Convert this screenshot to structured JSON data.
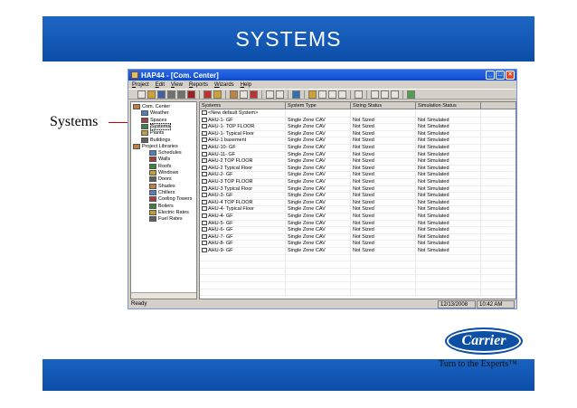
{
  "slide": {
    "title": "SYSTEMS",
    "side_label": "Systems",
    "logo_text": "Carrier",
    "tagline": "Turn to the Experts™",
    "colors": {
      "banner": "#0c4ea8",
      "arrow": "#cc0000"
    }
  },
  "window": {
    "title": "HAP44 - [Com. Center]",
    "controls": [
      "_",
      "□",
      "×"
    ],
    "menu": [
      "Project",
      "Edit",
      "View",
      "Reports",
      "Wizards",
      "Help"
    ]
  },
  "tree": [
    {
      "label": "Com. Center",
      "indent": 0,
      "icon": "folder-icon"
    },
    {
      "label": "Weather",
      "indent": 1,
      "icon": "weather-icon"
    },
    {
      "label": "Spaces",
      "indent": 1,
      "icon": "spaces-icon"
    },
    {
      "label": "Systems",
      "indent": 1,
      "icon": "systems-icon",
      "selected": true
    },
    {
      "label": "Plants",
      "indent": 1,
      "icon": "plants-icon"
    },
    {
      "label": "Buildings",
      "indent": 1,
      "icon": "buildings-icon"
    },
    {
      "label": "Project Libraries",
      "indent": 0,
      "icon": "libraries-icon"
    },
    {
      "label": "Schedules",
      "indent": 2,
      "icon": "schedules-icon"
    },
    {
      "label": "Walls",
      "indent": 2,
      "icon": "walls-icon"
    },
    {
      "label": "Roofs",
      "indent": 2,
      "icon": "roofs-icon"
    },
    {
      "label": "Windows",
      "indent": 2,
      "icon": "windows-icon"
    },
    {
      "label": "Doors",
      "indent": 2,
      "icon": "doors-icon"
    },
    {
      "label": "Shades",
      "indent": 2,
      "icon": "shades-icon"
    },
    {
      "label": "Chillers",
      "indent": 2,
      "icon": "chillers-icon"
    },
    {
      "label": "Cooling Towers",
      "indent": 2,
      "icon": "cooling-towers-icon"
    },
    {
      "label": "Boilers",
      "indent": 2,
      "icon": "boilers-icon"
    },
    {
      "label": "Electric Rates",
      "indent": 2,
      "icon": "electric-rates-icon"
    },
    {
      "label": "Fuel Rates",
      "indent": 2,
      "icon": "fuel-rates-icon"
    }
  ],
  "list": {
    "columns": [
      "Systems",
      "System Type",
      "Sizing Status",
      "Simulation Status"
    ],
    "rows": [
      [
        "<New default System>",
        "",
        "",
        ""
      ],
      [
        "AHU-1- GF",
        "Single Zone CAV",
        "Not Sized",
        "Not Simulated"
      ],
      [
        "AHU-1- TOP FLOOR",
        "Single Zone CAV",
        "Not Sized",
        "Not Simulated"
      ],
      [
        "AHU-1- Typical Floor",
        "Single Zone CAV",
        "Not Sized",
        "Not Simulated"
      ],
      [
        "AHU-1 basement",
        "Single Zone CAV",
        "Not Sized",
        "Not Simulated"
      ],
      [
        "AHU-10- GF",
        "Single Zone CAV",
        "Not Sized",
        "Not Simulated"
      ],
      [
        "AHU-11- GF",
        "Single Zone CAV",
        "Not Sized",
        "Not Simulated"
      ],
      [
        "AHU-2 TOP FLOOR",
        "Single Zone CAV",
        "Not Sized",
        "Not Simulated"
      ],
      [
        "AHU-2 Typical Floor",
        "Single Zone CAV",
        "Not Sized",
        "Not Simulated"
      ],
      [
        "AHU-2- GF",
        "Single Zone CAV",
        "Not Sized",
        "Not Simulated"
      ],
      [
        "AHU-3 TOP FLOOR",
        "Single Zone CAV",
        "Not Sized",
        "Not Simulated"
      ],
      [
        "AHU-3 Typical Floor",
        "Single Zone CAV",
        "Not Sized",
        "Not Simulated"
      ],
      [
        "AHU-3- GF",
        "Single Zone CAV",
        "Not Sized",
        "Not Simulated"
      ],
      [
        "AHU-4 TOP FLOOR",
        "Single Zone CAV",
        "Not Sized",
        "Not Simulated"
      ],
      [
        "AHU-4- Typical Floor",
        "Single Zone CAV",
        "Not Sized",
        "Not Simulated"
      ],
      [
        "AHU-4- GF",
        "Single Zone CAV",
        "Not Sized",
        "Not Simulated"
      ],
      [
        "AHU-5- GF",
        "Single Zone CAV",
        "Not Sized",
        "Not Simulated"
      ],
      [
        "AHU-6- GF",
        "Single Zone CAV",
        "Not Sized",
        "Not Simulated"
      ],
      [
        "AHU-7- GF",
        "Single Zone CAV",
        "Not Sized",
        "Not Simulated"
      ],
      [
        "AHU-8- GF",
        "Single Zone CAV",
        "Not Sized",
        "Not Simulated"
      ],
      [
        "AHU-9- GF",
        "Single Zone CAV",
        "Not Sized",
        "Not Simulated"
      ]
    ]
  },
  "status": {
    "text": "Ready",
    "date": "12/13/2008",
    "time": "10:42 AM"
  }
}
